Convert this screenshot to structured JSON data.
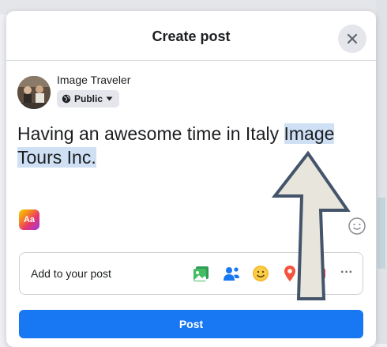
{
  "dialog": {
    "title": "Create post",
    "close_icon": "close-icon"
  },
  "author": {
    "name": "Image Traveler",
    "audience": "Public",
    "audience_icon": "globe-icon",
    "dropdown_icon": "caret-down-icon"
  },
  "post": {
    "text_plain": "Having an awesome time in Italy ",
    "text_selected_line1": "Image",
    "text_selected_line2": "Tours Inc."
  },
  "composer": {
    "font_button_label": "Aa",
    "emoji_icon": "smiley-icon"
  },
  "add_to_post": {
    "label": "Add to your post",
    "tools": [
      "photo-video-icon",
      "tag-people-icon",
      "feeling-icon",
      "location-icon",
      "gif-icon",
      "more-icon"
    ],
    "more_label": "···"
  },
  "actions": {
    "post_label": "Post"
  },
  "colors": {
    "primary": "#1877f2",
    "selection": "#cfe0f5",
    "annotation_fill": "#e8e6dc",
    "annotation_stroke": "#44546a"
  }
}
